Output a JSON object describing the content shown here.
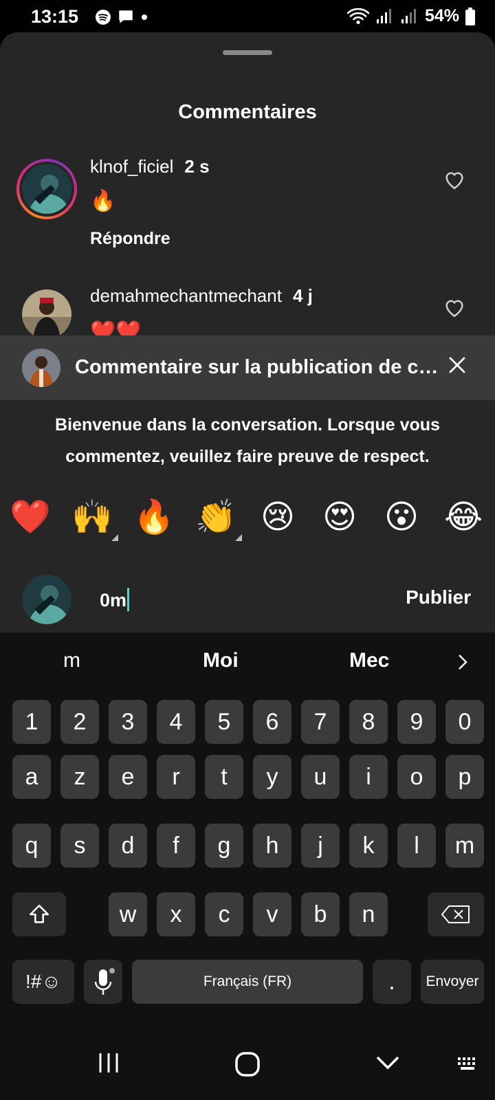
{
  "status": {
    "time": "13:15",
    "battery": "54%",
    "icons": [
      "spotify-icon",
      "message-icon",
      "dot-icon",
      "wifi-icon",
      "signal-icon",
      "battery-icon"
    ]
  },
  "sheet": {
    "title": "Commentaires"
  },
  "comments": [
    {
      "username": "klnof_ficiel",
      "time": "2 s",
      "text": "🔥",
      "reply_label": "Répondre"
    },
    {
      "username": "demahmechantmechant",
      "time": "4 j",
      "text": "❤️❤️"
    }
  ],
  "banner": {
    "text": "Commentaire sur la publication de c…"
  },
  "welcome": {
    "line1": "Bienvenue dans la conversation. Lorsque vous",
    "line2": "commentez, veuillez faire preuve de respect."
  },
  "emojis": [
    "❤️",
    "🙌",
    "🔥",
    "👏",
    "😢",
    "😍",
    "😮",
    "😂"
  ],
  "composer": {
    "value": "0m",
    "publish_label": "Publier"
  },
  "keyboard": {
    "suggestions": [
      "m",
      "Moi",
      "Mec"
    ],
    "row_numbers": [
      "1",
      "2",
      "3",
      "4",
      "5",
      "6",
      "7",
      "8",
      "9",
      "0"
    ],
    "row1": [
      "a",
      "z",
      "e",
      "r",
      "t",
      "y",
      "u",
      "i",
      "o",
      "p"
    ],
    "row2": [
      "q",
      "s",
      "d",
      "f",
      "g",
      "h",
      "j",
      "k",
      "l",
      "m"
    ],
    "row3": [
      "w",
      "x",
      "c",
      "v",
      "b",
      "n"
    ],
    "symbols_label": "!#☺",
    "space_label": "Français (FR)",
    "period_label": ".",
    "send_label": "Envoyer"
  },
  "colors": {
    "sheet_bg": "#262626",
    "banner_bg": "#3a3a3a",
    "key_bg": "#3b3b3b",
    "caret": "#5ad3c6"
  }
}
